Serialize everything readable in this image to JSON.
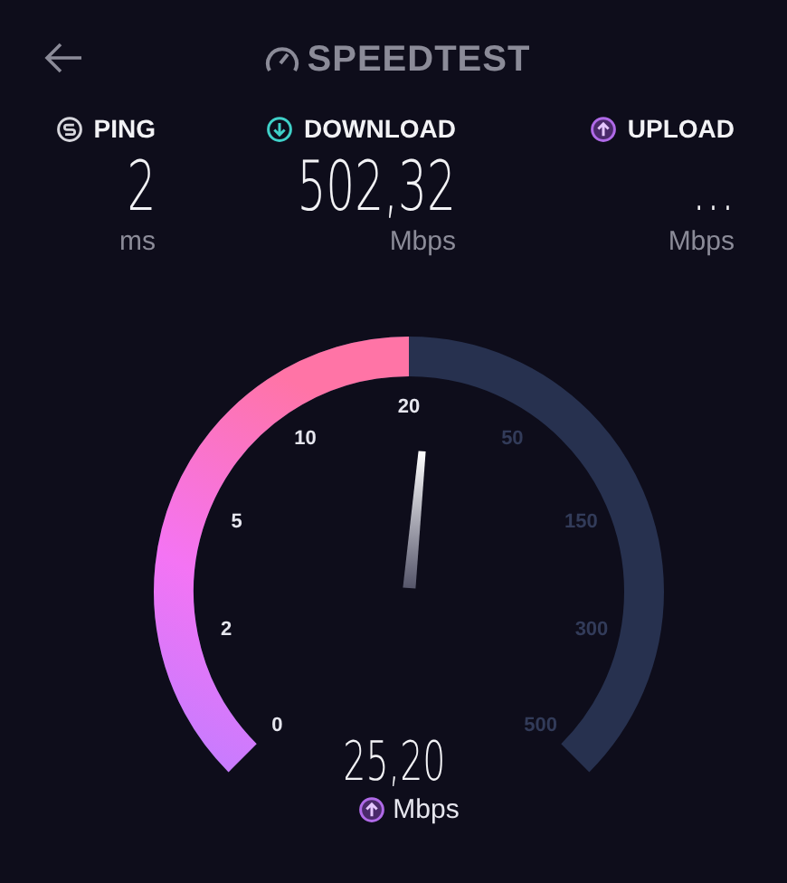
{
  "header": {
    "title": "SPEEDTEST"
  },
  "metrics": [
    {
      "kind": "ping",
      "label": "PING",
      "value": "2",
      "unit": "ms"
    },
    {
      "kind": "download",
      "label": "DOWNLOAD",
      "value": "502,32",
      "unit": "Mbps"
    },
    {
      "kind": "upload",
      "label": "UPLOAD",
      "value": "...",
      "unit": "Mbps"
    }
  ],
  "gauge": {
    "reading": "25,20",
    "unit": "Mbps",
    "ticks": [
      {
        "label": "0",
        "lit": true
      },
      {
        "label": "2",
        "lit": true
      },
      {
        "label": "5",
        "lit": true
      },
      {
        "label": "10",
        "lit": true
      },
      {
        "label": "20",
        "lit": true
      },
      {
        "label": "50",
        "lit": false
      },
      {
        "label": "150",
        "lit": false
      },
      {
        "label": "300",
        "lit": false
      },
      {
        "label": "500",
        "lit": false
      }
    ]
  }
}
